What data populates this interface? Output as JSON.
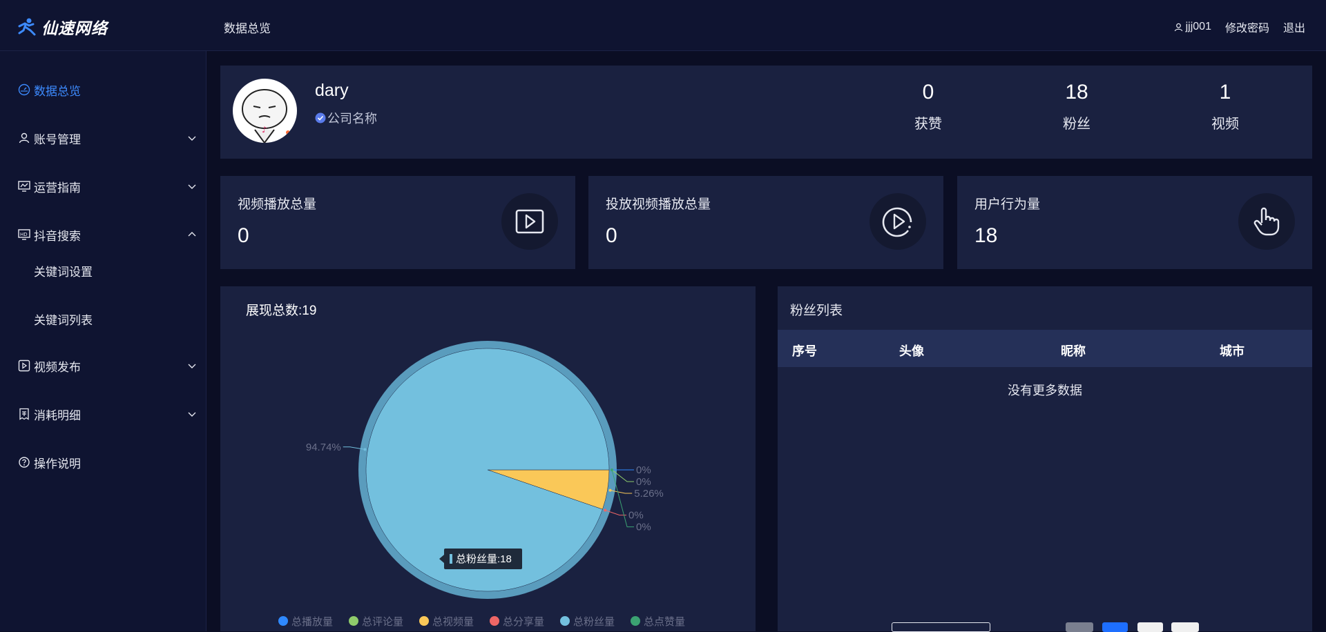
{
  "header": {
    "brand": "仙速网络",
    "crumb": "数据总览",
    "user": "jjj001",
    "change_password": "修改密码",
    "logout": "退出"
  },
  "sidebar": {
    "items": [
      {
        "label": "数据总览",
        "icon": "dashboard-icon",
        "active": true
      },
      {
        "label": "账号管理",
        "icon": "user-icon"
      },
      {
        "label": "运营指南",
        "icon": "monitor-chart-icon"
      },
      {
        "label": "抖音搜索",
        "icon": "hd-screen-icon",
        "expanded": true
      },
      {
        "label": "视频发布",
        "icon": "video-play-icon"
      },
      {
        "label": "消耗明细",
        "icon": "receipt-icon"
      },
      {
        "label": "操作说明",
        "icon": "help-circle-icon"
      }
    ],
    "submenu": [
      "关键词设置",
      "关键词列表"
    ]
  },
  "profile": {
    "name": "dary",
    "company": "公司名称",
    "stats": [
      {
        "value": "0",
        "label": "获赞"
      },
      {
        "value": "18",
        "label": "粉丝"
      },
      {
        "value": "1",
        "label": "视频"
      }
    ]
  },
  "metrics": [
    {
      "label": "视频播放总量",
      "value": "0",
      "icon": "video-square-play-icon"
    },
    {
      "label": "投放视频播放总量",
      "value": "0",
      "icon": "circle-play-icon"
    },
    {
      "label": "用户行为量",
      "value": "18",
      "icon": "hand-pointer-icon"
    }
  ],
  "chart_card": {
    "title_prefix": "展现总数:",
    "title_value": "19"
  },
  "chart_data": {
    "type": "pie",
    "title": "展现总数:19",
    "series": [
      {
        "name": "总播放量",
        "value": 0,
        "color": "#2f89ff",
        "label": "0%"
      },
      {
        "name": "总评论量",
        "value": 0,
        "color": "#8fcb6b",
        "label": "0%"
      },
      {
        "name": "总视频量",
        "value": 1,
        "color": "#fac858",
        "label": "5.26%"
      },
      {
        "name": "总分享量",
        "value": 0,
        "color": "#ee6666",
        "label": "0%"
      },
      {
        "name": "总粉丝量",
        "value": 18,
        "color": "#73c0de",
        "label": "94.74%"
      },
      {
        "name": "总点赞量",
        "value": 0,
        "color": "#3ba272",
        "label": "0%"
      }
    ],
    "tooltip": "总粉丝量:18",
    "legend_position": "bottom"
  },
  "fans": {
    "title": "粉丝列表",
    "columns": [
      "序号",
      "头像",
      "昵称",
      "城市"
    ],
    "empty_text": "没有更多数据"
  },
  "colors": {
    "accent": "#3d8bff",
    "panel": "#1a2140",
    "background": "#0b0e24"
  }
}
